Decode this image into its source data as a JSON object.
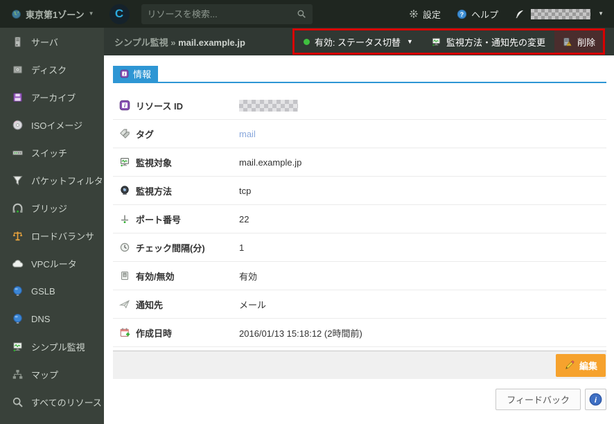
{
  "glyphs": {
    "caret_down": "▼"
  },
  "topbar": {
    "zone_label": "東京第1ゾーン",
    "logo_letter": "C",
    "search_placeholder": "リソースを検索...",
    "settings_label": "設定",
    "help_label": "ヘルプ",
    "user_name_redacted": true
  },
  "sidebar": {
    "items": [
      {
        "key": "server",
        "label": "サーバ",
        "icon": "server-icon"
      },
      {
        "key": "disk",
        "label": "ディスク",
        "icon": "disk-icon"
      },
      {
        "key": "archive",
        "label": "アーカイブ",
        "icon": "archive-icon"
      },
      {
        "key": "iso-image",
        "label": "ISOイメージ",
        "icon": "iso-icon"
      },
      {
        "key": "switch",
        "label": "スイッチ",
        "icon": "switch-icon"
      },
      {
        "key": "packet-filter",
        "label": "パケットフィルタ",
        "icon": "filter-icon"
      },
      {
        "key": "bridge",
        "label": "ブリッジ",
        "icon": "bridge-icon"
      },
      {
        "key": "load-balancer",
        "label": "ロードバランサ",
        "icon": "loadbalancer-icon"
      },
      {
        "key": "vpc-router",
        "label": "VPCルータ",
        "icon": "cloud-icon"
      },
      {
        "key": "gslb",
        "label": "GSLB",
        "icon": "globe-icon"
      },
      {
        "key": "dns",
        "label": "DNS",
        "icon": "globe-icon"
      },
      {
        "key": "simple-monitor",
        "label": "シンプル監視",
        "icon": "monitor-icon"
      },
      {
        "key": "map",
        "label": "マップ",
        "icon": "sitemap-icon"
      },
      {
        "key": "all-resources",
        "label": "すべてのリソース",
        "icon": "search-icon"
      }
    ]
  },
  "breadcrumb": {
    "section": "シンプル監視",
    "separator": "»",
    "resource": "mail.example.jp"
  },
  "actions": {
    "status_button": {
      "label": "有効: ステータス切替",
      "status_color": "#3fc13f"
    },
    "change_button": {
      "label": "監視方法・通知先の変更",
      "icon": "monitor-icon"
    },
    "delete_button": {
      "label": "削除",
      "icon": "delete-icon"
    },
    "highlight_color": "#d80000"
  },
  "tab": {
    "label": "情報",
    "icon": "info-icon"
  },
  "info_table": {
    "rows": [
      {
        "key": "resource-id",
        "label": "リソース ID",
        "icon": "info-icon",
        "value": "",
        "redacted": true
      },
      {
        "key": "tags",
        "label": "タグ",
        "icon": "tag-icon",
        "value": "mail",
        "link": true
      },
      {
        "key": "target",
        "label": "監視対象",
        "icon": "monitor-icon",
        "value": "mail.example.jp"
      },
      {
        "key": "method",
        "label": "監視方法",
        "icon": "camera-icon",
        "value": "tcp"
      },
      {
        "key": "port",
        "label": "ポート番号",
        "icon": "port-icon",
        "value": "22"
      },
      {
        "key": "interval",
        "label": "チェック間隔(分)",
        "icon": "clock-icon",
        "value": "1"
      },
      {
        "key": "enabled",
        "label": "有効/無効",
        "icon": "toggle-icon",
        "value": "有効"
      },
      {
        "key": "notify",
        "label": "通知先",
        "icon": "send-icon",
        "value": "メール"
      },
      {
        "key": "created",
        "label": "作成日時",
        "icon": "calendar-icon",
        "value": "2016/01/13 15:18:12 (2時間前)"
      }
    ]
  },
  "footer_bar": {
    "edit_label": "編集"
  },
  "page_footer": {
    "feedback_label": "フィードバック"
  },
  "colors": {
    "topbar_bg": "#1f2620",
    "sidebar_bg": "#39413a",
    "actionbar_bg": "#303833",
    "tab_blue": "#2e96d4",
    "edit_orange": "#f6a22d",
    "delete_bg": "#4a2d2d",
    "highlight_red": "#d80000",
    "tag_link": "#88a7dc",
    "status_green": "#3fc13f"
  }
}
